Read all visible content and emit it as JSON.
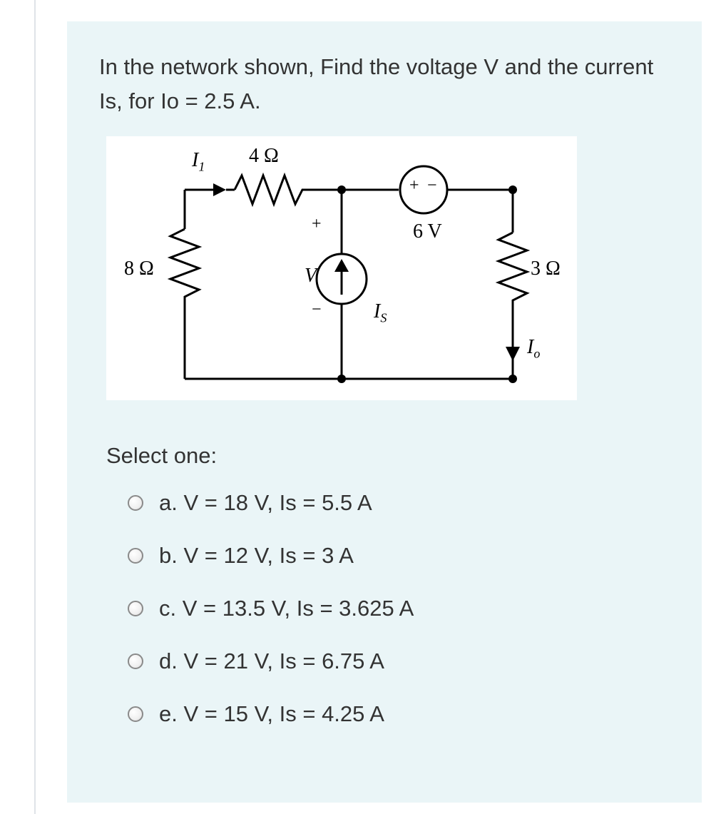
{
  "question": {
    "prompt": "In the network shown, Find the voltage V and the current Is, for Io = 2.5 A."
  },
  "circuit_labels": {
    "I1": "I",
    "I1_sub": "1",
    "R4": "4 Ω",
    "R8": "8 Ω",
    "R3": "3 Ω",
    "V6": "6 V",
    "Vlabel": "V",
    "Is": "I",
    "Is_sub": "S",
    "Io": "I",
    "Io_sub": "o",
    "plus": "+",
    "minus": "−",
    "src_plus": "+",
    "src_minus": "−",
    "V_plus": "+",
    "V_minus": "−"
  },
  "select_label": "Select one:",
  "options": [
    {
      "label": "a. V = 18 V, Is = 5.5 A"
    },
    {
      "label": "b. V = 12 V, Is = 3 A"
    },
    {
      "label": "c. V = 13.5 V, Is = 3.625 A"
    },
    {
      "label": "d. V = 21 V, Is = 6.75 A"
    },
    {
      "label": "e. V = 15 V, Is = 4.25 A"
    }
  ]
}
